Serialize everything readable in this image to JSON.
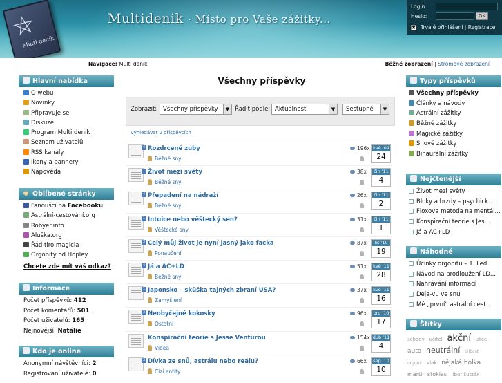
{
  "header": {
    "site_title": "Multidenik",
    "tagline": "· Místo pro Vaše zážitky...",
    "login_label": "Login:",
    "password_label": "Heslo:",
    "ok_label": "OK",
    "remember_check": "✖",
    "remember_label": "Trvalé přihlášení",
    "separator": "|",
    "register_link": "Registrace",
    "book_label": "Multi deník",
    "book_symbol": "⛤"
  },
  "navigation": {
    "label": "Navigace:",
    "current": "Multi deník",
    "view_normal": "Běžné zobrazení",
    "view_separator": "|",
    "view_tree": "Stromové zobrazení"
  },
  "left": {
    "main_menu": {
      "title": "Hlavní nabídka",
      "items": [
        {
          "label": "O webu",
          "color": "#3d7bd0"
        },
        {
          "label": "Novinky",
          "color": "#e0a020"
        },
        {
          "label": "Připravuje se",
          "color": "#9b8"
        },
        {
          "label": "Diskuze",
          "color": "#6ab"
        },
        {
          "label": "Program Multi deník",
          "color": "#3c7"
        },
        {
          "label": "Seznam uživatelů",
          "color": "#c97"
        },
        {
          "label": "RSS kanály",
          "color": "#f80"
        },
        {
          "label": "Ikony a bannery",
          "color": "#36a"
        },
        {
          "label": "Nápověda",
          "color": "#d90"
        }
      ]
    },
    "favorites": {
      "title": "Oblíbené stránky",
      "items": [
        {
          "prefix": "Fanoušci na ",
          "bold": "Facebooku",
          "color": "#3b5998"
        },
        {
          "prefix": "Astrální-cestování.org",
          "bold": "",
          "color": "#7a7"
        },
        {
          "prefix": "Robyer.info",
          "bold": "",
          "color": "#888"
        },
        {
          "prefix": "Aluška.org",
          "bold": "",
          "color": "#a5a"
        },
        {
          "prefix": "Řád tiro magicia",
          "bold": "",
          "color": "#444"
        },
        {
          "prefix": "Orgonity od Hopley",
          "bold": "",
          "color": "#5a5"
        }
      ],
      "link_question": "Chcete zde mít váš odkaz?"
    },
    "info": {
      "title": "Informace",
      "rows": [
        {
          "label": "Počet příspěvků:",
          "value": "412"
        },
        {
          "label": "Počet komentářů:",
          "value": "501"
        },
        {
          "label": "Počet uživatelů:",
          "value": "165"
        },
        {
          "label": "Nejnovější:",
          "value": "Natálie"
        }
      ]
    },
    "online": {
      "title": "Kdo je online",
      "rows": [
        {
          "label": "Anonymní návštěvníci:",
          "value": "2"
        },
        {
          "label": "Registrovaní uživatelé:",
          "value": "0"
        }
      ]
    }
  },
  "main": {
    "title": "Všechny příspěvky",
    "show_label": "Zobrazit:",
    "show_value": "Všechny příspěvky",
    "sort_label": "Řadit podle:",
    "sort_value": "Aktuálnosti",
    "order_value": "Sestupně",
    "dropdown_arrow": "▼",
    "search_link": "Vyhledávat v příspěvcích",
    "posts": [
      {
        "title": "Rozdrcené zuby",
        "category": "Běžné sny",
        "views": "196x",
        "month": "kvě '09",
        "day": "24",
        "count": "4"
      },
      {
        "title": "Život mezi světy",
        "category": "Běžné sny",
        "views": "38x",
        "month": "čin '11",
        "day": "4",
        "count": "1"
      },
      {
        "title": "Přepadení na nádraží",
        "category": "Běžné sny",
        "views": "26x",
        "month": "čin '11",
        "day": "2",
        "count": "4"
      },
      {
        "title": "Intuice nebo věštecký sen?",
        "category": "Věštecké sny",
        "views": "31x",
        "month": "čin '11",
        "day": "1",
        "count": "1"
      },
      {
        "title": "Celý můj život je nyní jasný jako facka",
        "category": "Ponaučení",
        "views": "87x",
        "month": "lis '10",
        "day": "19",
        "count": "3"
      },
      {
        "title": "Já a AC+LD",
        "category": "Běžné sny",
        "views": "51x",
        "month": "kvě '11",
        "day": "28",
        "count": "4"
      },
      {
        "title": "Japonsko – sküška tajných zbraní USA?",
        "category": "Zamyšlení",
        "views": "37x",
        "month": "kvě '11",
        "day": "16",
        "count": "1"
      },
      {
        "title": "Neobyčejné kokosky",
        "category": "Ostatní",
        "views": "96x",
        "month": "pro '10",
        "day": "17",
        "count": "3"
      },
      {
        "title": "Konspirační teorie s Jesse Venturou",
        "category": "Videa",
        "views": "154x",
        "month": "dub '11",
        "day": "4",
        "count": ""
      },
      {
        "title": "Dívka ze snů, astrálu nebo reálu?",
        "category": "Cizí entity",
        "views": "66x",
        "month": "sep '10",
        "day": "10",
        "count": "3"
      }
    ]
  },
  "right": {
    "types": {
      "title": "Typy příspěvků",
      "items": [
        {
          "label": "Všechny příspěvky",
          "color": "#555"
        },
        {
          "label": "Články a návody",
          "color": "#48a"
        },
        {
          "label": "Astrální zážitky",
          "color": "#7a9"
        },
        {
          "label": "Běžné zážitky",
          "color": "#c93"
        },
        {
          "label": "Magické zážitky",
          "color": "#b7c"
        },
        {
          "label": "Snové zážitky",
          "color": "#d90"
        },
        {
          "label": "Binaurální zážitky",
          "color": "#8a5"
        }
      ]
    },
    "most_read": {
      "title": "Nejčtenější",
      "items": [
        "Život mezi světy",
        "Bloky a brzdy – psychick...",
        "Floxova metoda na mentál...",
        "Konspirační teorie s Jes...",
        "Já a AC+LD"
      ]
    },
    "random": {
      "title": "Náhodné",
      "items": [
        "Účinky orgonitu – 1. Led",
        "Návod na prodloužení LD...",
        "Nahrávání informací",
        "Deja-vu ve snu",
        "Mé „první“ astrální cest..."
      ]
    },
    "tags": {
      "title": "Štítky",
      "items": [
        {
          "text": "schody",
          "size": 7,
          "color": "#999"
        },
        {
          "text": "učitel",
          "size": 7,
          "color": "#999"
        },
        {
          "text": "akční",
          "size": 13,
          "color": "#333"
        },
        {
          "text": "ulice",
          "size": 7,
          "color": "#999"
        },
        {
          "text": "auto",
          "size": 9,
          "color": "#888"
        },
        {
          "text": "neutrální",
          "size": 11,
          "color": "#555"
        },
        {
          "text": "bilbost",
          "size": 6,
          "color": "#aaa"
        },
        {
          "text": "orgonit",
          "size": 6,
          "color": "#aaa"
        },
        {
          "text": "vlak",
          "size": 7,
          "color": "#999"
        },
        {
          "text": "nějaká holka",
          "size": 9,
          "color": "#777"
        },
        {
          "text": "martin stoklas",
          "size": 8,
          "color": "#888"
        },
        {
          "text": "libor šusták",
          "size": 7,
          "color": "#999"
        }
      ]
    }
  }
}
